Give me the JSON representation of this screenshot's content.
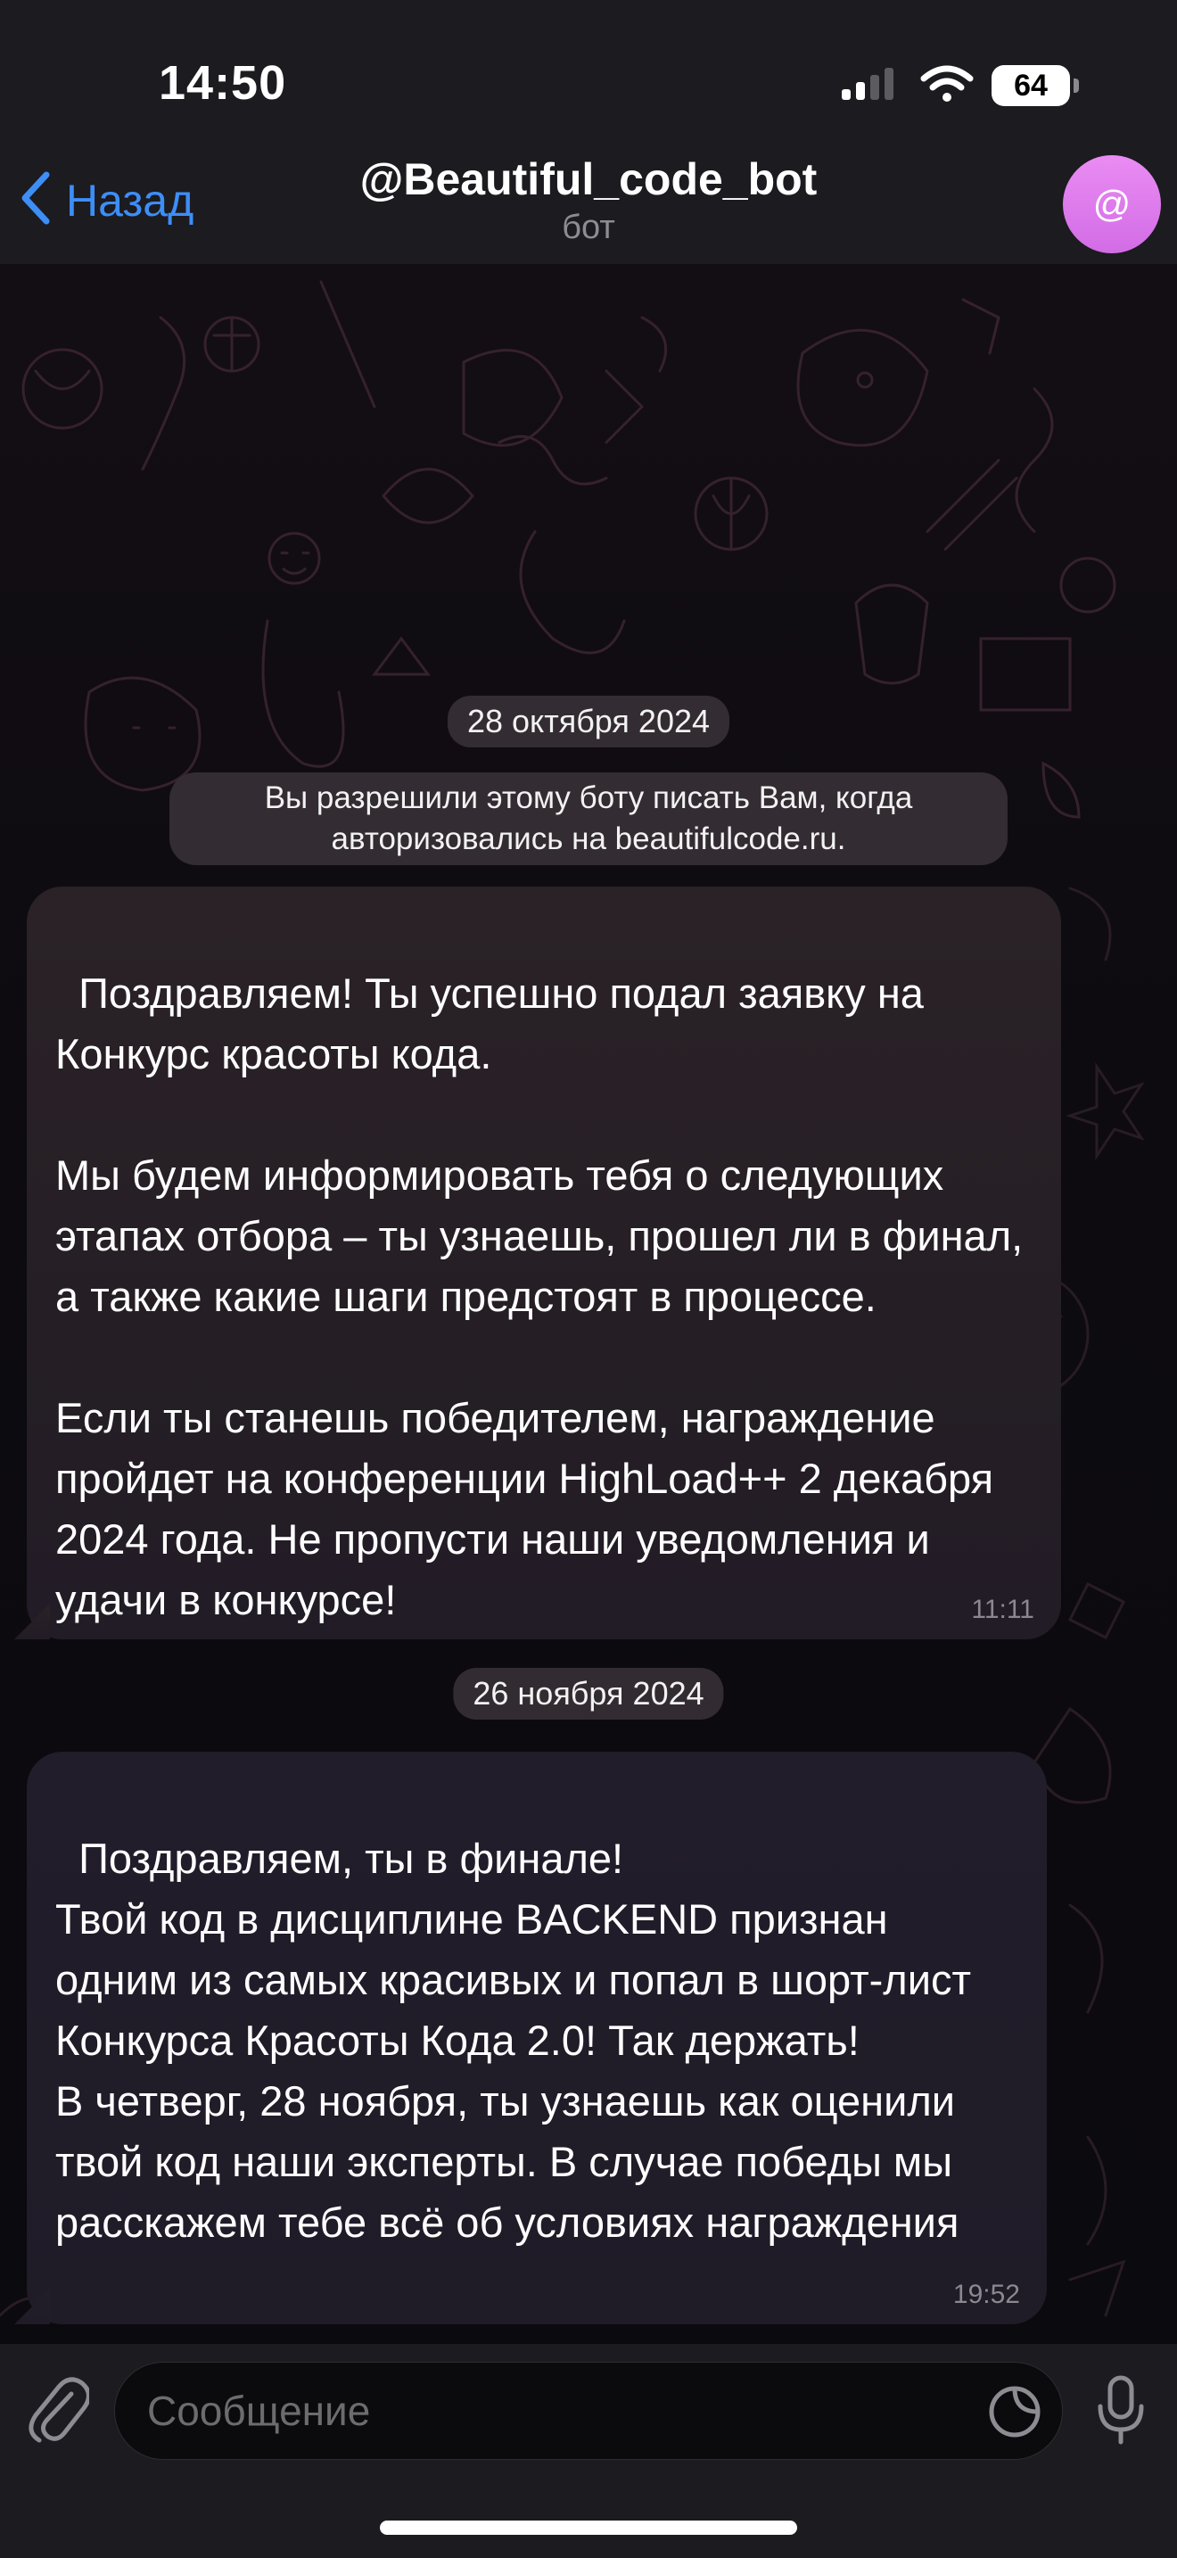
{
  "status_bar": {
    "time": "14:50",
    "battery": "64"
  },
  "header": {
    "back_label": "Назад",
    "title": "@Beautiful_code_bot",
    "subtitle": "бот",
    "avatar_text": "@"
  },
  "chat": {
    "date_1": "28 октября 2024",
    "service_message": "Вы разрешили этому боту писать Вам, когда авторизовались на beautifulcode.ru.",
    "messages": [
      {
        "text": "Поздравляем! Ты успешно подал заявку на Конкурс красоты кода.\n\nМы будем информировать тебя о следующих этапах отбора – ты узнаешь, прошел ли в финал, а также какие шаги предстоят в процессе.\n\nЕсли ты станешь победителем, награждение пройдет на конференции HighLoad++ 2 декабря 2024 года. Не пропусти наши уведомления и удачи в конкурсе!",
        "time": "11:11"
      },
      {
        "text": "Поздравляем, ты в финале!\nТвой код в дисциплине BACKEND признан одним из самых красивых и попал в шорт-лист Конкурса Красоты Кода 2.0! Так держать!\nВ четверг, 28 ноября, ты узнаешь как оценили твой код наши эксперты. В случае победы мы расскажем тебе всё об условиях награждения",
        "time": "19:52"
      }
    ],
    "date_2": "26 ноября 2024"
  },
  "input": {
    "placeholder": "Сообщение"
  },
  "icons": {
    "back": "chevron-left-icon",
    "attach": "paperclip-icon",
    "sticker": "sticker-icon",
    "mic": "microphone-icon",
    "signal": "signal-icon",
    "wifi": "wifi-icon"
  },
  "colors": {
    "accent": "#3d8ef7",
    "avatar": "#e07ff0",
    "background": "#0b0a0d"
  }
}
